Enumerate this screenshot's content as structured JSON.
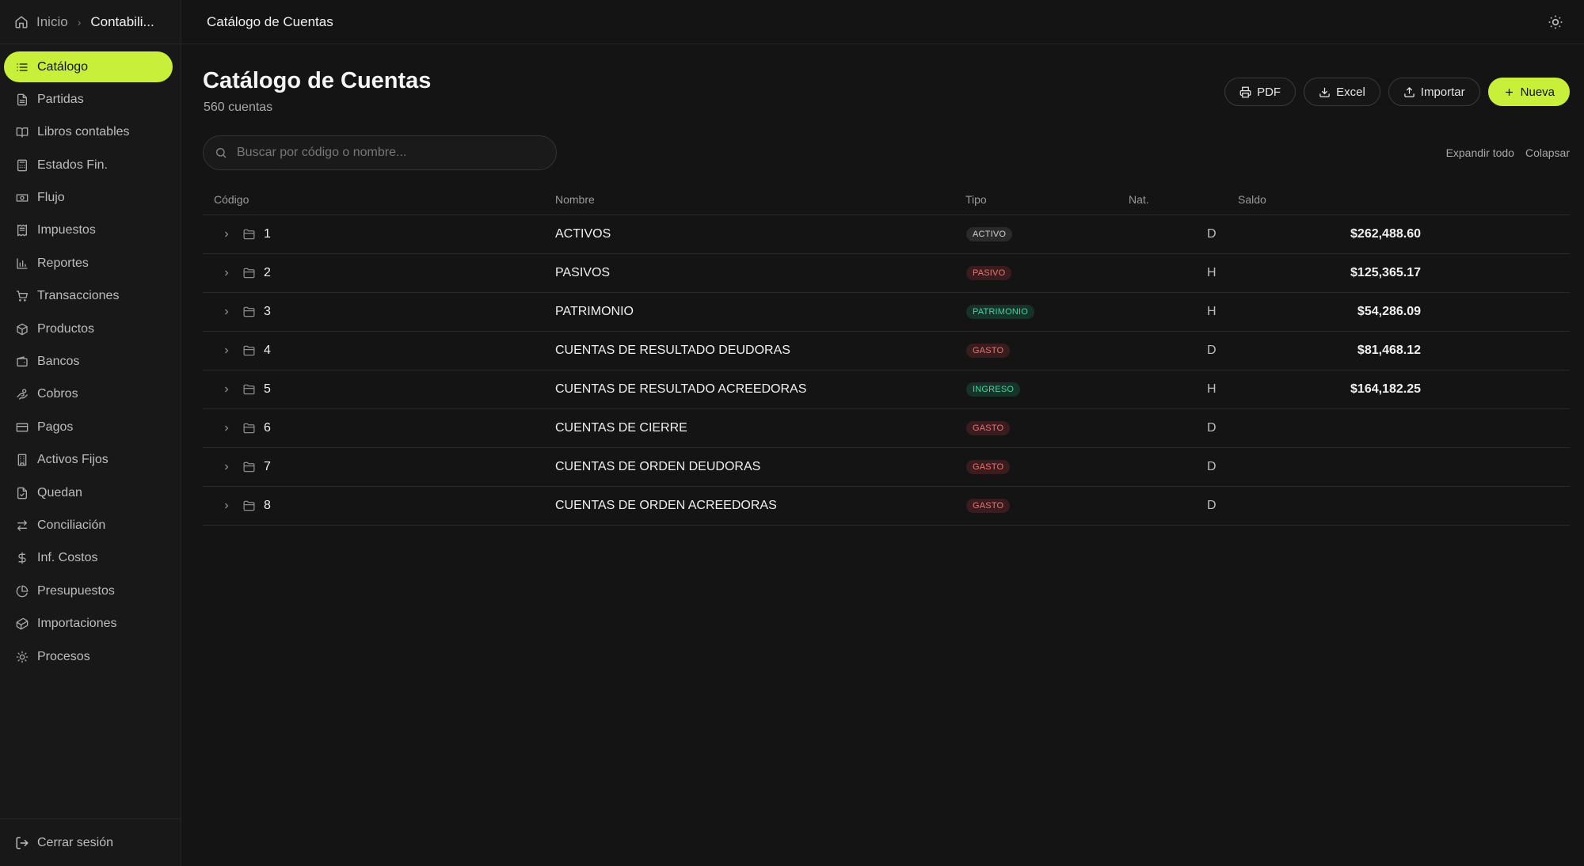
{
  "breadcrumb": {
    "home": "Inicio",
    "current": "Contabili..."
  },
  "topbar": {
    "title": "Catálogo de Cuentas"
  },
  "nav": [
    {
      "label": "Catálogo",
      "icon": "list-icon",
      "active": true
    },
    {
      "label": "Partidas",
      "icon": "file-text-icon"
    },
    {
      "label": "Libros contables",
      "icon": "book-icon"
    },
    {
      "label": "Estados Fin.",
      "icon": "calculator-icon"
    },
    {
      "label": "Flujo",
      "icon": "banknote-icon"
    },
    {
      "label": "Impuestos",
      "icon": "receipt-icon"
    },
    {
      "label": "Reportes",
      "icon": "bar-chart-icon"
    },
    {
      "label": "Transacciones",
      "icon": "cart-icon"
    },
    {
      "label": "Productos",
      "icon": "package-icon"
    },
    {
      "label": "Bancos",
      "icon": "wallet-icon"
    },
    {
      "label": "Cobros",
      "icon": "hand-coins-icon"
    },
    {
      "label": "Pagos",
      "icon": "credit-card-icon"
    },
    {
      "label": "Activos Fijos",
      "icon": "building-icon"
    },
    {
      "label": "Quedan",
      "icon": "file-check-icon"
    },
    {
      "label": "Conciliación",
      "icon": "arrows-exchange-icon"
    },
    {
      "label": "Inf. Costos",
      "icon": "dollar-icon"
    },
    {
      "label": "Presupuestos",
      "icon": "pie-chart-icon"
    },
    {
      "label": "Importaciones",
      "icon": "container-icon"
    },
    {
      "label": "Procesos",
      "icon": "cog-icon"
    }
  ],
  "footer": {
    "logout": "Cerrar sesión"
  },
  "header": {
    "title": "Catálogo de Cuentas",
    "subtitle": "560 cuentas"
  },
  "actions": {
    "pdf": "PDF",
    "excel": "Excel",
    "import": "Importar",
    "new": "Nueva"
  },
  "search": {
    "placeholder": "Buscar por código o nombre..."
  },
  "tree": {
    "expand": "Expandir todo",
    "collapse": "Colapsar"
  },
  "columns": {
    "code": "Código",
    "name": "Nombre",
    "type": "Tipo",
    "nat": "Nat.",
    "balance": "Saldo"
  },
  "colors": {
    "accent": "#c8f03a",
    "danger": "#f2706a",
    "success": "#45d39a"
  },
  "rows": [
    {
      "code": "1",
      "name": "ACTIVOS",
      "type": "ACTIVO",
      "badge": "activo",
      "nat": "D",
      "balance": "$262,488.60"
    },
    {
      "code": "2",
      "name": "PASIVOS",
      "type": "PASIVO",
      "badge": "pasivo",
      "nat": "H",
      "balance": "$125,365.17"
    },
    {
      "code": "3",
      "name": "PATRIMONIO",
      "type": "PATRIMONIO",
      "badge": "patrimonio",
      "nat": "H",
      "balance": "$54,286.09"
    },
    {
      "code": "4",
      "name": "CUENTAS DE RESULTADO DEUDORAS",
      "type": "GASTO",
      "badge": "gasto",
      "nat": "D",
      "balance": "$81,468.12"
    },
    {
      "code": "5",
      "name": "CUENTAS DE RESULTADO ACREEDORAS",
      "type": "INGRESO",
      "badge": "ingreso",
      "nat": "H",
      "balance": "$164,182.25"
    },
    {
      "code": "6",
      "name": "CUENTAS DE CIERRE",
      "type": "GASTO",
      "badge": "gasto",
      "nat": "D",
      "balance": ""
    },
    {
      "code": "7",
      "name": "CUENTAS DE ORDEN DEUDORAS",
      "type": "GASTO",
      "badge": "gasto",
      "nat": "D",
      "balance": ""
    },
    {
      "code": "8",
      "name": "CUENTAS DE ORDEN ACREEDORAS",
      "type": "GASTO",
      "badge": "gasto",
      "nat": "D",
      "balance": ""
    }
  ]
}
